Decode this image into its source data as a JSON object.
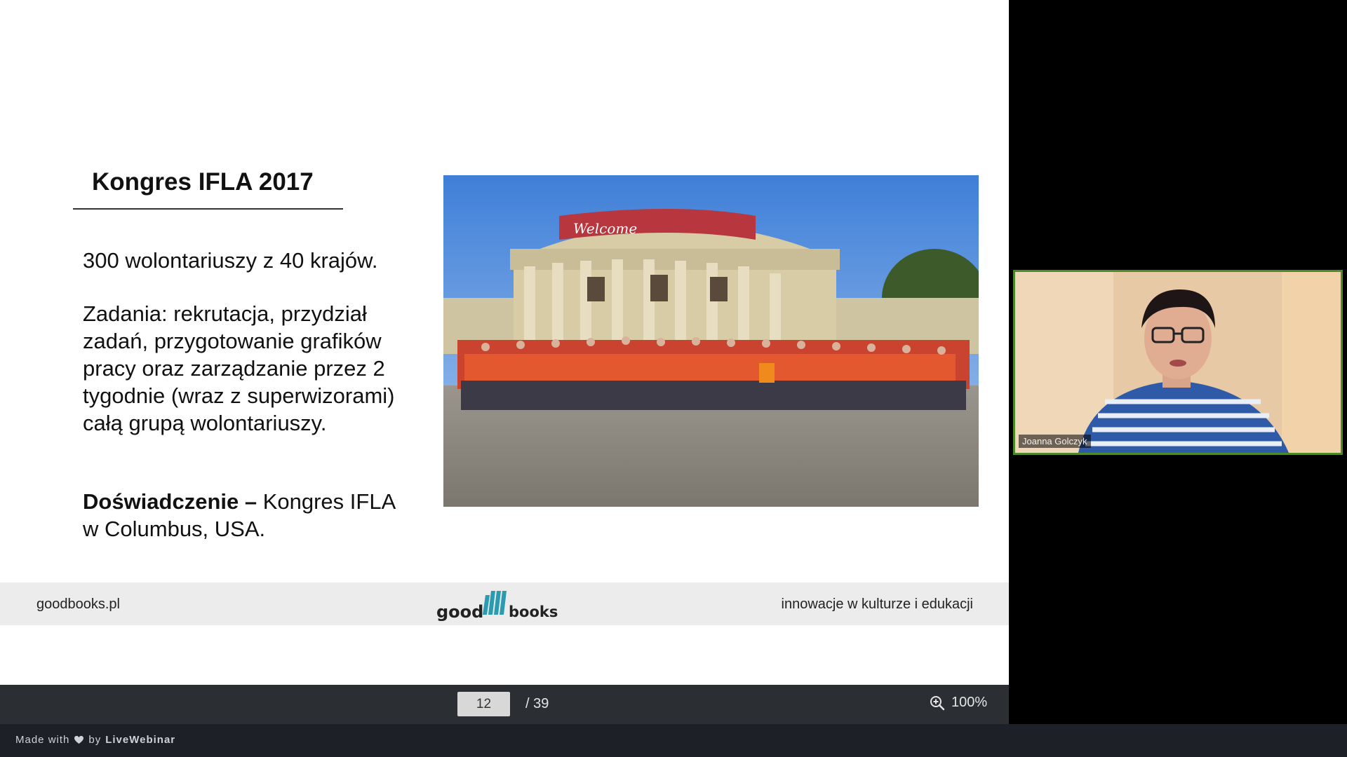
{
  "slide": {
    "title": "Kongres IFLA 2017",
    "para1": "300 wolontariuszy z 40 krajów.",
    "para2": "Zadania: rekrutacja, przydział zadań, przygotowanie grafików pracy oraz zarządzanie przez 2 tygodnie (wraz z superwizorami) całą grupą wolontariuszy.",
    "para3_bold": "Doświadczenie –",
    "para3_rest": " Kongres IFLA w Columbus, USA.",
    "photo_banner": "Welcome",
    "footer_left": "goodbooks.pl",
    "footer_right": "innowacje w kulturze i edukacji",
    "logo_left": "good",
    "logo_right": "books"
  },
  "controls": {
    "page_current": "12",
    "page_total": "/ 39",
    "zoom": "100%",
    "zoom_icon": "zoom-in-icon"
  },
  "brandbar": {
    "made_with": "Made with",
    "by": "by",
    "brand": "LiveWebinar",
    "heart_icon": "heart-icon"
  },
  "webcam": {
    "participant_name": "Joanna Golczyk"
  },
  "colors": {
    "accent_logo": "#2a9bb0",
    "webcam_border": "#4e8a2a",
    "controls_bg": "#2b2e33"
  }
}
